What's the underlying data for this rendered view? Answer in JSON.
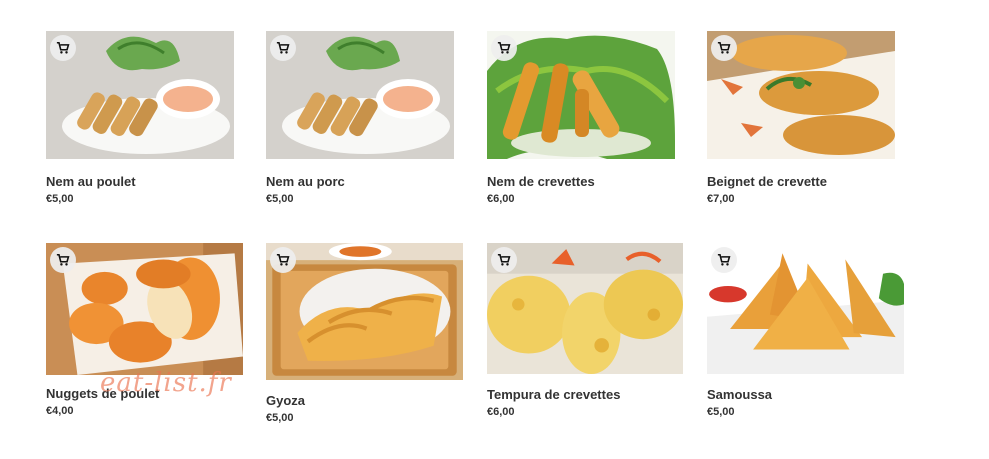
{
  "products": [
    {
      "name": "Nem au poulet",
      "price": "€5,00",
      "cart_icon": "cart-icon",
      "image": "spring-rolls-with-sauce"
    },
    {
      "name": "Nem au porc",
      "price": "€5,00",
      "cart_icon": "cart-icon",
      "image": "spring-rolls-with-sauce"
    },
    {
      "name": "Nem de crevettes",
      "price": "€6,00",
      "cart_icon": "cart-icon",
      "image": "fried-rolls-on-lettuce"
    },
    {
      "name": "Beignet de crevette",
      "price": "€7,00",
      "cart_icon": "cart-icon",
      "image": "shrimp-fritters"
    },
    {
      "name": "Nuggets de poulet",
      "price": "€4,00",
      "cart_icon": "cart-icon",
      "image": "chicken-nuggets"
    },
    {
      "name": "Gyoza",
      "price": "€5,00",
      "cart_icon": "cart-icon",
      "image": "gyoza-on-tray"
    },
    {
      "name": "Tempura de crevettes",
      "price": "€6,00",
      "cart_icon": "cart-icon",
      "image": "shrimp-tempura"
    },
    {
      "name": "Samoussa",
      "price": "€5,00",
      "cart_icon": "cart-icon",
      "image": "samosas"
    }
  ],
  "watermark": "eat-list.fr"
}
